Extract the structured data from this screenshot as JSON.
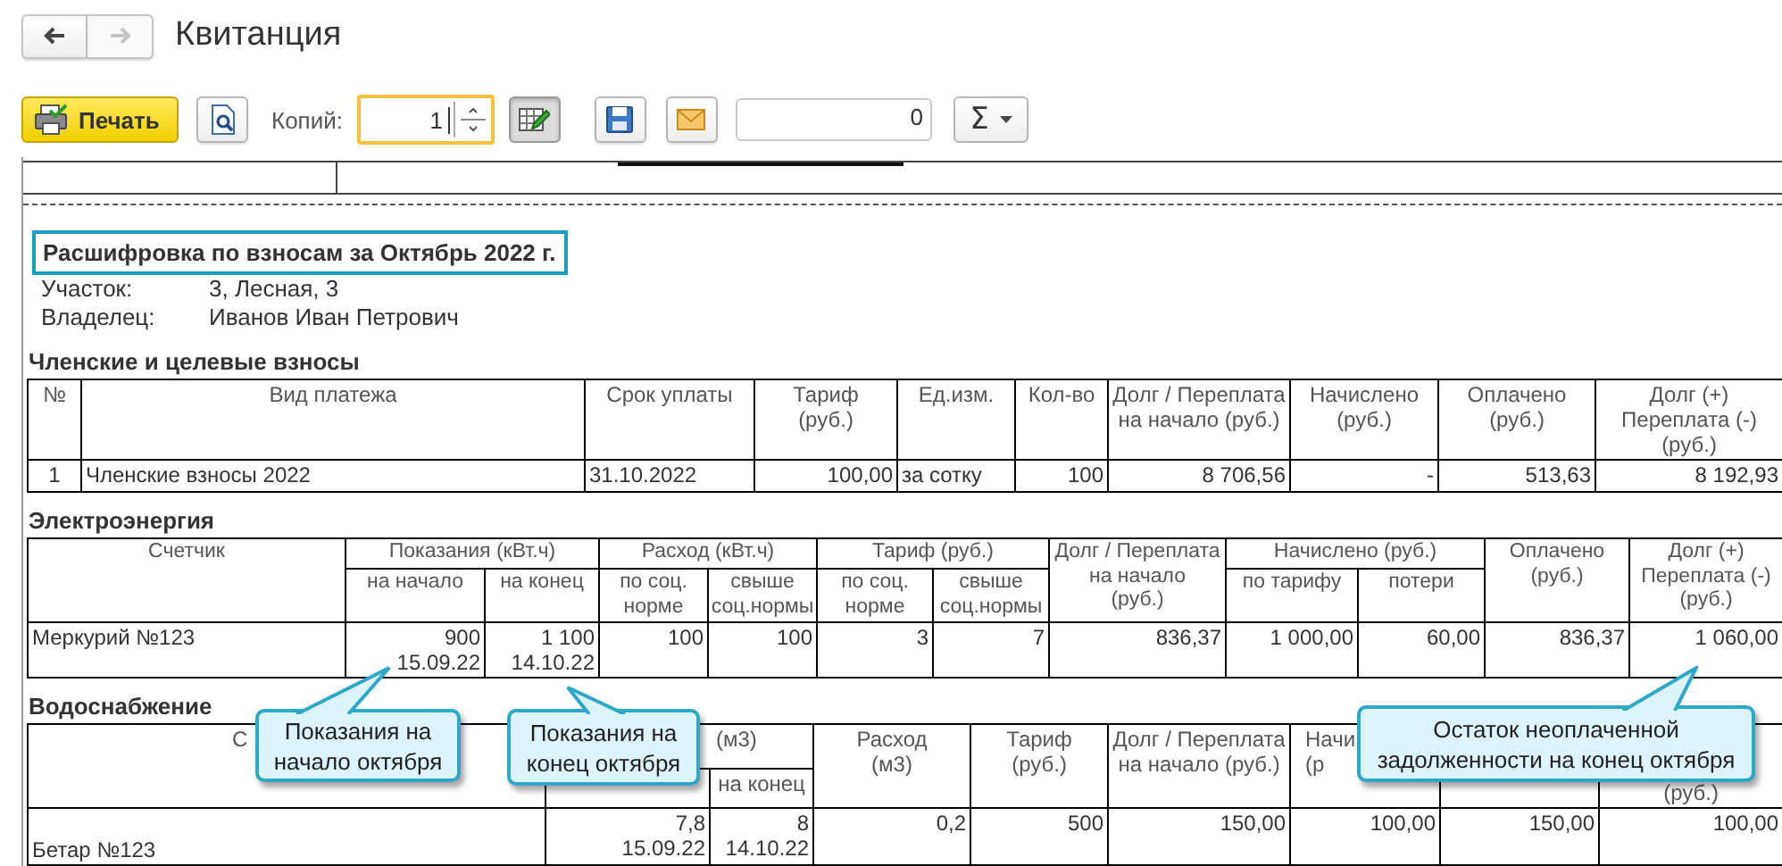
{
  "window": {
    "title": "Квитанция"
  },
  "navigation": [
    {
      "kind": "back",
      "disabled": false
    },
    {
      "kind": "forward",
      "disabled": true
    }
  ],
  "toolbar": {
    "print_button": "Печать",
    "copies_label": "Копий:",
    "copies_value": "1",
    "edit_mode": {
      "on": true
    },
    "amount_value": "0",
    "sum_button": "Σ"
  },
  "report": {
    "heading": "Расшифровка по взносам за Октябрь 2022 г.",
    "details": [
      {
        "label": "Участок:",
        "value": "3, Лесная, 3"
      },
      {
        "label": "Владелец:",
        "value": "Иванов Иван Петрович"
      }
    ],
    "sections": [
      {
        "kind": "fees",
        "title": "Членские и целевые взносы",
        "header": [
          [
            {
              "label": "№"
            },
            {
              "label": "Вид платежа"
            },
            {
              "label": "Срок уплаты"
            },
            {
              "label": "Тариф\n(руб.)"
            },
            {
              "label": "Ед.изм."
            },
            {
              "label": "Кол-во"
            },
            {
              "label": "Долг / Переплата\nна начало (руб.)"
            },
            {
              "label": "Начислено\n(руб.)"
            },
            {
              "label": "Оплачено\n(руб.)"
            },
            {
              "label": "Долг (+)\nПереплата (-)\n(руб.)"
            }
          ]
        ],
        "columns": [
          {
            "kind": "index"
          },
          {
            "kind": "text"
          },
          {
            "kind": "text"
          },
          {
            "kind": "number"
          },
          {
            "kind": "text"
          },
          {
            "kind": "number"
          },
          {
            "kind": "number"
          },
          {
            "kind": "number"
          },
          {
            "kind": "number"
          },
          {
            "kind": "number"
          }
        ],
        "rows": [
          [
            "1",
            "Членские взносы 2022",
            "31.10.2022",
            "100,00",
            "за сотку",
            "100",
            "8 706,56",
            "-",
            "513,63",
            "8 192,93"
          ]
        ]
      },
      {
        "kind": "electricity",
        "title": "Электроэнергия",
        "header": [
          [
            {
              "label": "Счетчик",
              "rowspan": 2
            },
            {
              "label": "Показания (кВт.ч)",
              "colspan": 2
            },
            {
              "label": "Расход (кВт.ч)",
              "colspan": 2
            },
            {
              "label": "Тариф (руб.)",
              "colspan": 2
            },
            {
              "label": "Долг / Переплата\nна начало\n(руб.)",
              "rowspan": 2
            },
            {
              "label": "Начислено (руб.)",
              "colspan": 2
            },
            {
              "label": "Оплачено\n(руб.)",
              "rowspan": 2
            },
            {
              "label": "Долг (+)\nПереплата (-)\n(руб.)",
              "rowspan": 2
            }
          ],
          [
            {
              "label": "на начало"
            },
            {
              "label": "на конец"
            },
            {
              "label": "по соц.\nнорме"
            },
            {
              "label": "свыше\nсоц.нормы"
            },
            {
              "label": "по соц.\nнорме"
            },
            {
              "label": "свыше\nсоц.нормы"
            },
            {
              "label": "по тарифу"
            },
            {
              "label": "потери"
            }
          ]
        ],
        "columns": [
          {
            "kind": "text"
          },
          {
            "kind": "number"
          },
          {
            "kind": "number"
          },
          {
            "kind": "number"
          },
          {
            "kind": "number"
          },
          {
            "kind": "number"
          },
          {
            "kind": "number"
          },
          {
            "kind": "number"
          },
          {
            "kind": "number"
          },
          {
            "kind": "number"
          },
          {
            "kind": "number"
          },
          {
            "kind": "number"
          }
        ],
        "rows": [
          [
            "Меркурий №123",
            "900\n15.09.22",
            "1 100\n14.10.22",
            "100",
            "100",
            "3",
            "7",
            "836,37",
            "1 000,00",
            "60,00",
            "836,37",
            "1 060,00"
          ]
        ]
      },
      {
        "kind": "water",
        "title": "Водоснабжение",
        "header": [
          [
            {
              "label": "С",
              "rowspan": 2
            },
            {
              "label": "(м3)",
              "colspan": 2
            },
            {
              "label": "Расход\n(м3)",
              "rowspan": 2
            },
            {
              "label": "Тариф\n(руб.)",
              "rowspan": 2
            },
            {
              "label": "Долг / Переплата\nна начало (руб.)",
              "rowspan": 2
            },
            {
              "label": "Начи\n(р",
              "rowspan": 2
            },
            {
              "kind": "blank",
              "rowspan": 2
            },
            {
              "label": "(руб.)",
              "rowspan": 2
            }
          ],
          [
            {
              "kind": "blank"
            },
            {
              "label": "на конец"
            }
          ]
        ],
        "columns": [
          {
            "kind": "text"
          },
          {
            "kind": "number"
          },
          {
            "kind": "number"
          },
          {
            "kind": "number"
          },
          {
            "kind": "number"
          },
          {
            "kind": "number"
          },
          {
            "kind": "number"
          },
          {
            "kind": "number"
          },
          {
            "kind": "number"
          }
        ],
        "rows": [
          [
            "Бетар №123",
            "7,8\n15.09.22",
            "8\n14.10.22",
            "0,2",
            "500",
            "150,00",
            "100,00",
            "150,00",
            "100,00"
          ]
        ]
      }
    ]
  },
  "callouts": [
    {
      "text": "Показания на\nначало октября"
    },
    {
      "text": "Показания на\nконец октября"
    },
    {
      "text": "Остаток неоплаченной\nзадолженности на конец октября"
    }
  ]
}
